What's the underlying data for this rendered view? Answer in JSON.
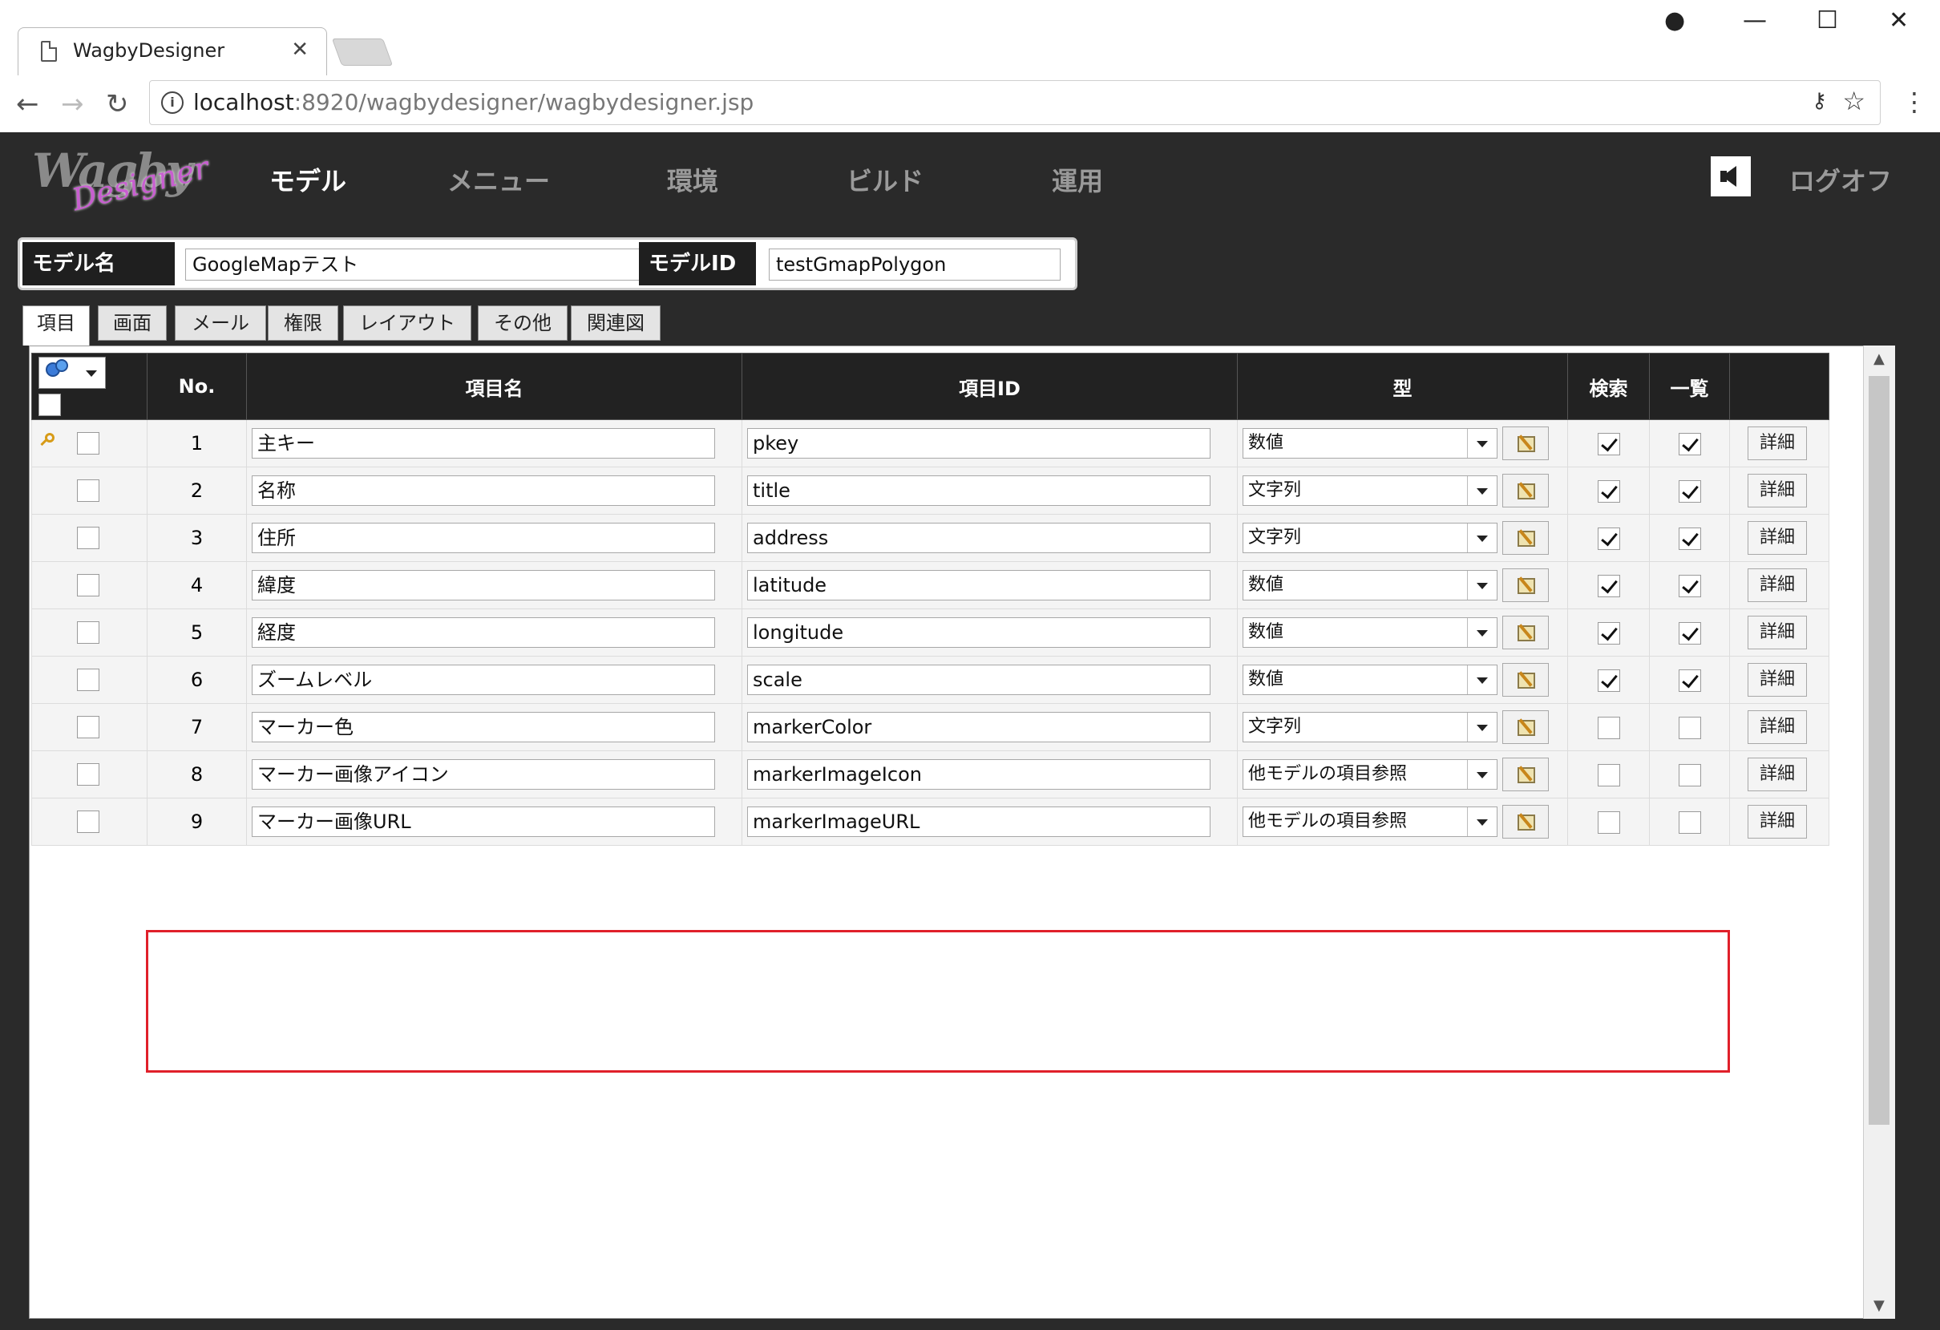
{
  "browser": {
    "tab_title": "WagbyDesigner",
    "url_host": "localhost",
    "url_rest": ":8920/wagbydesigner/wagbydesigner.jsp"
  },
  "app": {
    "logo_main": "Wagby",
    "logo_sub": "Designer",
    "nav": [
      "モデル",
      "メニュー",
      "環境",
      "ビルド",
      "運用"
    ],
    "logoff": "ログオフ"
  },
  "model": {
    "name_label": "モデル名",
    "name_value": "GoogleMapテスト",
    "id_label": "モデルID",
    "id_value": "testGmapPolygon"
  },
  "tabs": [
    "項目",
    "画面",
    "メール",
    "権限",
    "レイアウト",
    "その他",
    "関連図"
  ],
  "grid": {
    "headers": {
      "no": "No.",
      "name": "項目名",
      "id": "項目ID",
      "type": "型",
      "search": "検索",
      "list": "一覧"
    },
    "detail_label": "詳細",
    "rows": [
      {
        "no": "1",
        "name": "主キー",
        "id": "pkey",
        "type": "数値",
        "search": true,
        "list": true,
        "key": true
      },
      {
        "no": "2",
        "name": "名称",
        "id": "title",
        "type": "文字列",
        "search": true,
        "list": true
      },
      {
        "no": "3",
        "name": "住所",
        "id": "address",
        "type": "文字列",
        "search": true,
        "list": true
      },
      {
        "no": "4",
        "name": "緯度",
        "id": "latitude",
        "type": "数値",
        "search": true,
        "list": true
      },
      {
        "no": "5",
        "name": "経度",
        "id": "longitude",
        "type": "数値",
        "search": true,
        "list": true
      },
      {
        "no": "6",
        "name": "ズームレベル",
        "id": "scale",
        "type": "数値",
        "search": true,
        "list": true
      },
      {
        "no": "7",
        "name": "マーカー色",
        "id": "markerColor",
        "type": "文字列",
        "search": false,
        "list": false
      },
      {
        "no": "8",
        "name": "マーカー画像アイコン",
        "id": "markerImageIcon",
        "type": "他モデルの項目参照",
        "search": false,
        "list": false
      },
      {
        "no": "9",
        "name": "マーカー画像URL",
        "id": "markerImageURL",
        "type": "他モデルの項目参照",
        "search": false,
        "list": false
      }
    ]
  },
  "colors": {
    "header_bg": "#2a2a2a",
    "highlight": "#e0202a",
    "key_icon": "#d79b17"
  }
}
